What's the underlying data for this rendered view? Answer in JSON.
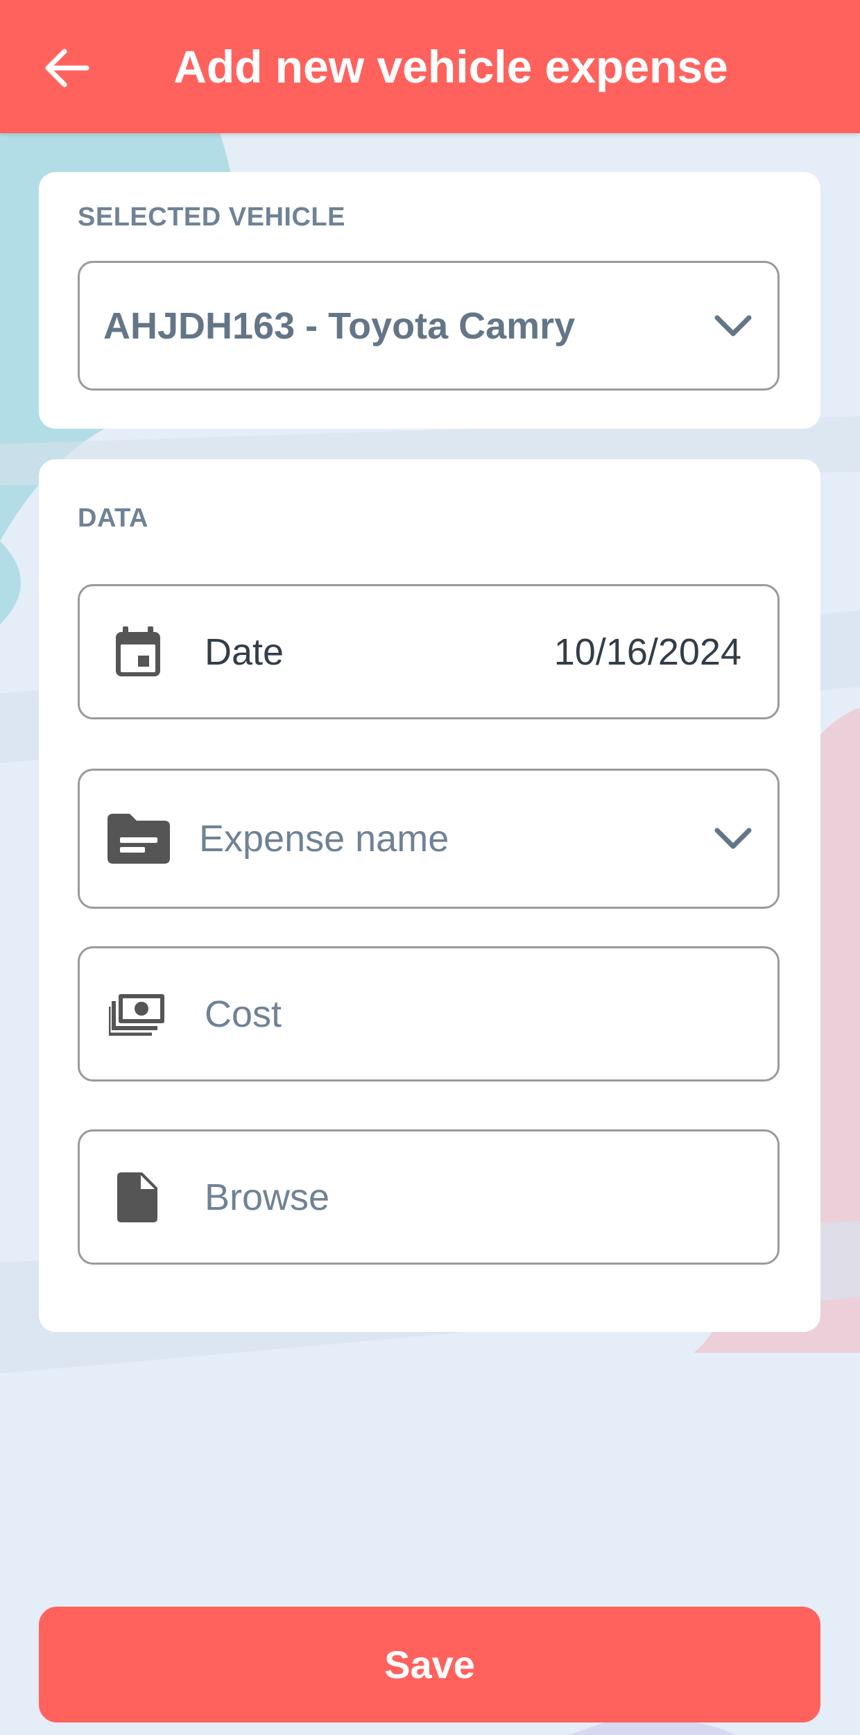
{
  "app_bar": {
    "title": "Add new vehicle expense",
    "icon": "arrow-left-icon",
    "color": "#ff625d"
  },
  "vehicle_section": {
    "label": "SELECTED VEHICLE",
    "selected_vehicle": "AHJDH163 - Toyota Camry"
  },
  "data_section": {
    "label": "DATA",
    "date": {
      "label": "Date",
      "value": "10/16/2024",
      "icon": "calendar-icon"
    },
    "expense_name": {
      "placeholder": "Expense name",
      "icon": "folder-icon"
    },
    "cost": {
      "placeholder": "Cost",
      "icon": "money-icon"
    },
    "attachment": {
      "placeholder": "Browse",
      "icon": "file-icon"
    }
  },
  "actions": {
    "save_label": "Save"
  },
  "colors": {
    "accent": "#ff625d",
    "background": "#e4edf8",
    "label_text": "#6f8296",
    "icon": "#555555"
  }
}
